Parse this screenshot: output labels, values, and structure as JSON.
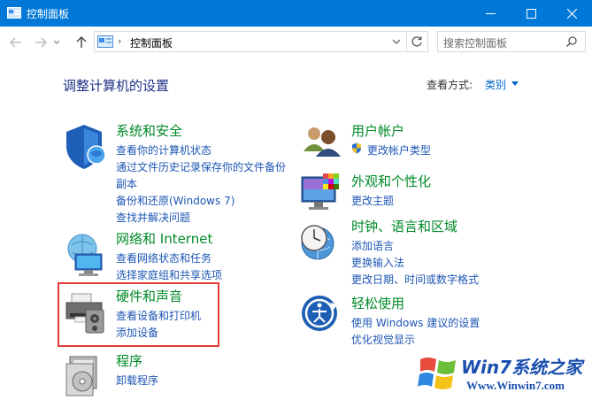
{
  "window": {
    "title": "控制面板",
    "controls": [
      "minimize",
      "maximize",
      "close"
    ]
  },
  "nav": {
    "breadcrumb_sep": "›",
    "breadcrumb": "控制面板",
    "search_placeholder": "搜索控制面板"
  },
  "main": {
    "heading": "调整计算机的设置",
    "view_by_label": "查看方式:",
    "view_by_value": "类别"
  },
  "categories": [
    {
      "title": "系统和安全",
      "icon": "shield-icon",
      "links": [
        "查看你的计算机状态",
        "通过文件历史记录保存你的文件备份",
        "副本",
        "备份和还原(Windows 7)",
        "查找并解决问题"
      ]
    },
    {
      "title": "网络和 Internet",
      "icon": "network-icon",
      "links": [
        "查看网络状态和任务",
        "选择家庭组和共享选项"
      ]
    },
    {
      "title": "硬件和声音",
      "icon": "printer-icon",
      "links": [
        "查看设备和打印机",
        "添加设备"
      ]
    },
    {
      "title": "程序",
      "icon": "programs-icon",
      "links": [
        "卸载程序"
      ]
    },
    {
      "title": "用户帐户",
      "icon": "users-icon",
      "links": [
        "更改帐户类型"
      ]
    },
    {
      "title": "外观和个性化",
      "icon": "monitor-icon",
      "links": [
        "更改主题"
      ]
    },
    {
      "title": "时钟、语言和区域",
      "icon": "clock-globe-icon",
      "links": [
        "添加语言",
        "更换输入法",
        "更改日期、时间或数字格式"
      ]
    },
    {
      "title": "轻松使用",
      "icon": "ease-of-access-icon",
      "links": [
        "使用 Windows 建议的设置",
        "优化视觉显示"
      ]
    }
  ],
  "watermark": {
    "brand": "Win7系统之家",
    "url": "Www.Winwin7.com"
  },
  "colors": {
    "titlebar": "#0078d7",
    "category_title": "#008a28",
    "link": "#1e56b4",
    "heading": "#1e3287",
    "highlight": "#e53a3a"
  }
}
